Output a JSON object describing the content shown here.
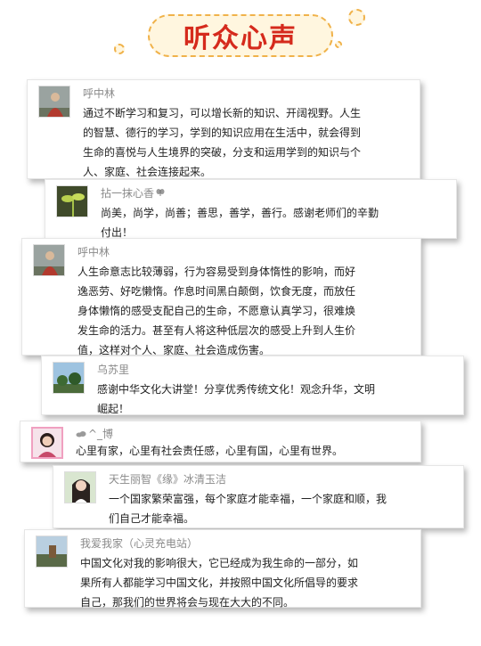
{
  "header": {
    "title": "听众心声"
  },
  "comments": [
    {
      "username": "呼中林",
      "avatar_icon": "person-in-red-shawl-photo",
      "lines": [
        "通过不断学习和复习，可以增长新的知识、开阔视野。人生",
        "的智慧、德行的学习，学到的知识应用在生活中，就会得到",
        "生命的喜悦与人生境界的突破，分支和运用学到的知识与个",
        "人、家庭、社会连接起来。"
      ]
    },
    {
      "username": "拈一抹心香",
      "username_suffix_icon": "butterfly-icon",
      "avatar_icon": "plant-sprout-photo",
      "lines": [
        "尚美，尚学，尚善；善思，善学，善行。感谢老师们的辛勤",
        "付出！"
      ]
    },
    {
      "username": "呼中林",
      "avatar_icon": "person-in-red-shawl-photo",
      "lines": [
        "人生命意志比较薄弱，行为容易受到身体惰性的影响，而好",
        "逸恶劳、好吃懒惰。作息时间黑白颠倒，饮食无度，而放任",
        "身体懒惰的感受支配自己的生命，不愿意认真学习，很难焕",
        "发生命的活力。甚至有人将这种低层次的感受上升到人生价",
        "值，这样对个人、家庭、社会造成伤害。"
      ]
    },
    {
      "username": "乌苏里",
      "avatar_icon": "landscape-trees-photo",
      "lines": [
        "感谢中华文化大讲堂！分享优秀传统文化！观念升华，文明",
        "崛起！"
      ]
    },
    {
      "username": "^_博",
      "username_prefix_icon": "cloud-icon",
      "avatar_icon": "girl-portrait-photo",
      "lines": [
        "心里有家，心里有社会责任感，心里有国，心里有世界。"
      ]
    },
    {
      "username": "天生丽智《缘》冰清玉洁",
      "avatar_icon": "woman-long-hair-photo",
      "lines": [
        "一个国家繁荣富强，每个家庭才能幸福，一个家庭和顺，我",
        "们自己才能幸福。"
      ]
    },
    {
      "username": "我爱我家（心灵充电站）",
      "avatar_icon": "outdoor-landscape-photo",
      "lines": [
        "中国文化对我的影响很大，它已经成为我生命的一部分，如",
        "果所有人都能学习中国文化，并按照中国文化所倡导的要求",
        "自己，那我们的世界将会与现在大大的不同。"
      ]
    }
  ]
}
